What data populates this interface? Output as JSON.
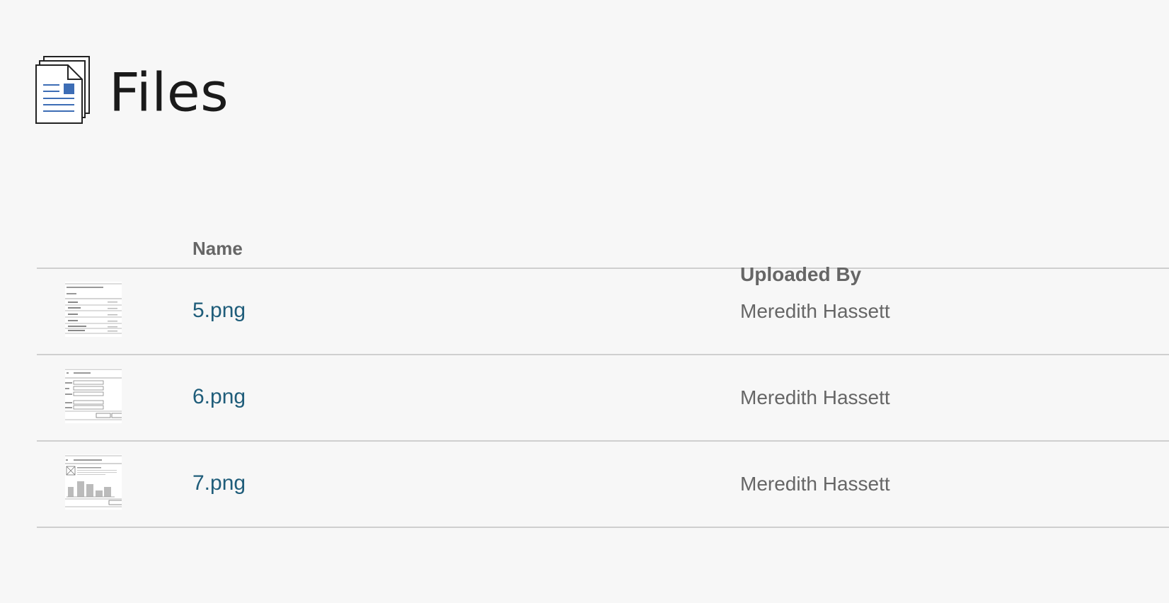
{
  "page": {
    "title": "Files",
    "title_icon": "files-stack-icon"
  },
  "table": {
    "columns": {
      "name": "Name",
      "uploaded_by": "Uploaded By"
    },
    "rows": [
      {
        "name": "5.png",
        "uploaded_by": "Meredith Hassett",
        "thumbnail": "inventory-list-thumbnail"
      },
      {
        "name": "6.png",
        "uploaded_by": "Meredith Hassett",
        "thumbnail": "order-form-thumbnail"
      },
      {
        "name": "7.png",
        "uploaded_by": "Meredith Hassett",
        "thumbnail": "bar-chart-thumbnail"
      }
    ]
  },
  "colors": {
    "background": "#f7f7f7",
    "link": "#1f5d7a",
    "muted_text": "#666666",
    "icon_accent": "#3d6db5",
    "divider": "#cfcfcf"
  }
}
